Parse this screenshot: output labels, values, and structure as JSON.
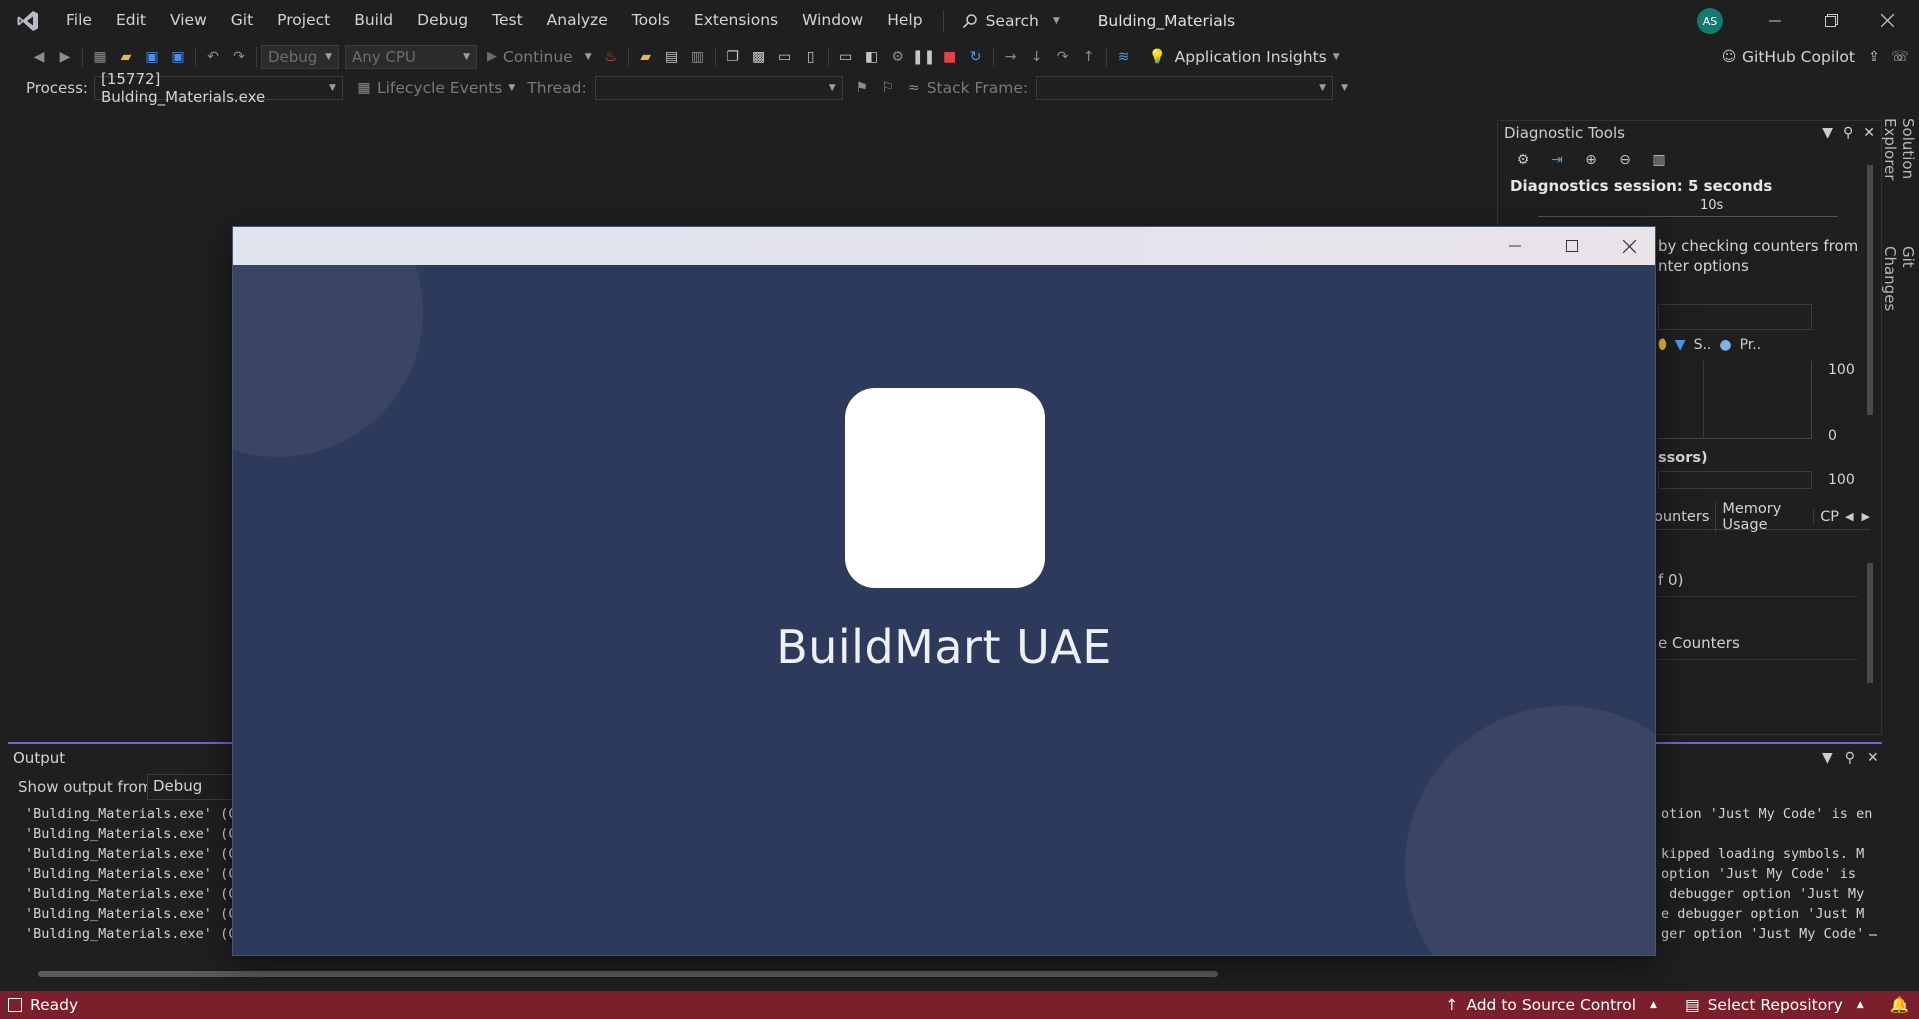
{
  "menu": {
    "items": [
      "File",
      "Edit",
      "View",
      "Git",
      "Project",
      "Build",
      "Debug",
      "Test",
      "Analyze",
      "Tools",
      "Extensions",
      "Window",
      "Help"
    ],
    "search_label": "Search",
    "solution_name": "Bulding_Materials",
    "user_initials": "AS"
  },
  "toolbar": {
    "config": "Debug",
    "platform": "Any CPU",
    "continue_label": "Continue",
    "app_insights_label": "Application Insights",
    "copilot_label": "GitHub Copilot"
  },
  "debug_location": {
    "process_label": "Process:",
    "process_value": "[15772] Bulding_Materials.exe",
    "lifecycle_label": "Lifecycle Events",
    "thread_label": "Thread:",
    "stack_frame_label": "Stack Frame:"
  },
  "diagnostics": {
    "title": "Diagnostic Tools",
    "session": "Diagnostics session: 5 seconds",
    "ruler_tick": "10s",
    "hint_line1": "by checking counters from",
    "hint_line2": "nter options",
    "legend_s": "S..",
    "legend_pr": "Pr..",
    "axis_top_1": "100",
    "axis_bottom_1": "0",
    "section_label": "ssors)",
    "axis_top_2": "100",
    "tabs": [
      "ounters",
      "Memory Usage",
      "CP"
    ],
    "summary_line": "f 0)",
    "counters_line": "e Counters"
  },
  "side_tabs": {
    "solution_explorer": "Solution Explorer",
    "git_changes": "Git Changes"
  },
  "output": {
    "title": "Output",
    "show_from_label": "Show output from:",
    "source": "Debug",
    "left_lines": [
      "'Bulding_Materials.exe' (C",
      "'Bulding_Materials.exe' (C",
      "'Bulding_Materials.exe' (C",
      "'Bulding_Materials.exe' (C",
      "'Bulding_Materials.exe' (C",
      "'Bulding_Materials.exe' (C",
      "'Bulding_Materials.exe' (C"
    ],
    "right_lines": [
      "otion 'Just My Code' is en",
      "",
      "kipped loading symbols. M",
      "option 'Just My Code' is",
      " debugger option 'Just My",
      "e debugger option 'Just M",
      "ger option 'Just My Code'"
    ]
  },
  "app": {
    "title": "BuildMart UAE",
    "colors": {
      "background": "#2e3a5b",
      "logo_box": "#ffffff"
    }
  },
  "status": {
    "ready": "Ready",
    "source_control": "Add to Source Control",
    "repository": "Select Repository",
    "notifications": "1",
    "bar_color": "#7a1f2b"
  }
}
